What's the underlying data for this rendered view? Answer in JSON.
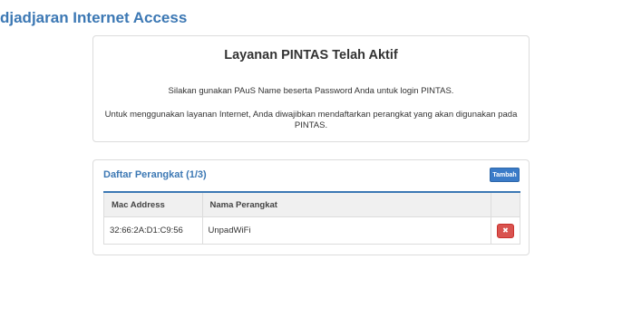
{
  "header": {
    "brand": "djadjaran Internet Access"
  },
  "info_card": {
    "title": "Layanan PINTAS Telah Aktif",
    "line1": "Silakan gunakan PAuS Name beserta Password Anda untuk login PINTAS.",
    "line2": "Untuk menggunakan layanan Internet, Anda diwajibkan mendaftarkan perangkat yang akan digunakan pada PINTAS."
  },
  "devices": {
    "title": "Daftar Perangkat (1/3)",
    "add_label": "Tambah",
    "columns": {
      "mac": "Mac Address",
      "name": "Nama Perangkat",
      "action": ""
    },
    "rows": [
      {
        "mac": "32:66:2A:D1:C9:56",
        "name": "UnpadWiFi",
        "delete_label": "✖"
      }
    ]
  },
  "colors": {
    "accent": "#3c78b4",
    "button_primary": "#3a7bc8",
    "button_danger": "#d9534f"
  },
  "icons": {
    "delete": "close-icon"
  }
}
